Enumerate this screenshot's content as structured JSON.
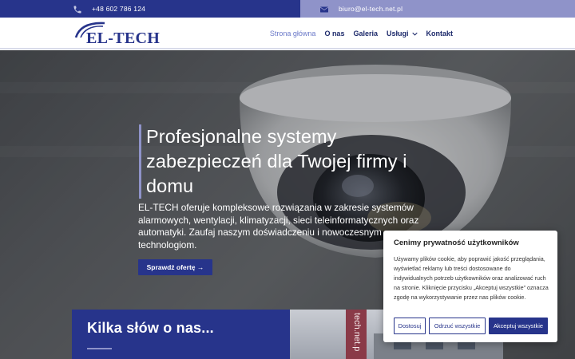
{
  "topbar": {
    "phone_icon": "phone-icon",
    "phone": "+48 602 786 124",
    "mail_icon": "envelope-icon",
    "email": "biuro@el-tech.net.pl"
  },
  "header": {
    "logo_text": "EL-TECH",
    "nav": [
      {
        "label": "Strona główna",
        "active": true
      },
      {
        "label": "O nas"
      },
      {
        "label": "Galeria"
      },
      {
        "label": "Usługi",
        "has_dropdown": true
      },
      {
        "label": "Kontakt"
      }
    ]
  },
  "hero": {
    "title": "Profesjonalne systemy zabezpieczeń dla Twojej firmy i domu",
    "text": "EL-TECH oferuje kompleksowe rozwiązania w zakresie systemów alarmowych, wentylacji, klimatyzacji, sieci teleinformatycznych oraz automatyki. Zaufaj naszym doświadczeniu i nowoczesnym technologiom.",
    "button": "Sprawdź ofertę →"
  },
  "about": {
    "title": "Kilka słów o nas...",
    "banner_text": "tech.net.p"
  },
  "cookie": {
    "title": "Cenimy prywatność użytkowników",
    "text": "Używamy plików cookie, aby poprawić jakość przeglądania, wyświetlać reklamy lub treści dostosowane do indywidualnych potrzeb użytkowników oraz analizować ruch na stronie. Kliknięcie przycisku „Akceptuj wszystkie” oznacza zgodę na wykorzystywanie przez nas plików cookie.",
    "customize": "Dostosuj",
    "reject": "Odrzuć wszystkie",
    "accept": "Akceptuj wszystkie"
  },
  "colors": {
    "brand_dark": "#27348b",
    "brand_light": "#8f93c9",
    "nav_active": "#6a78c8"
  }
}
